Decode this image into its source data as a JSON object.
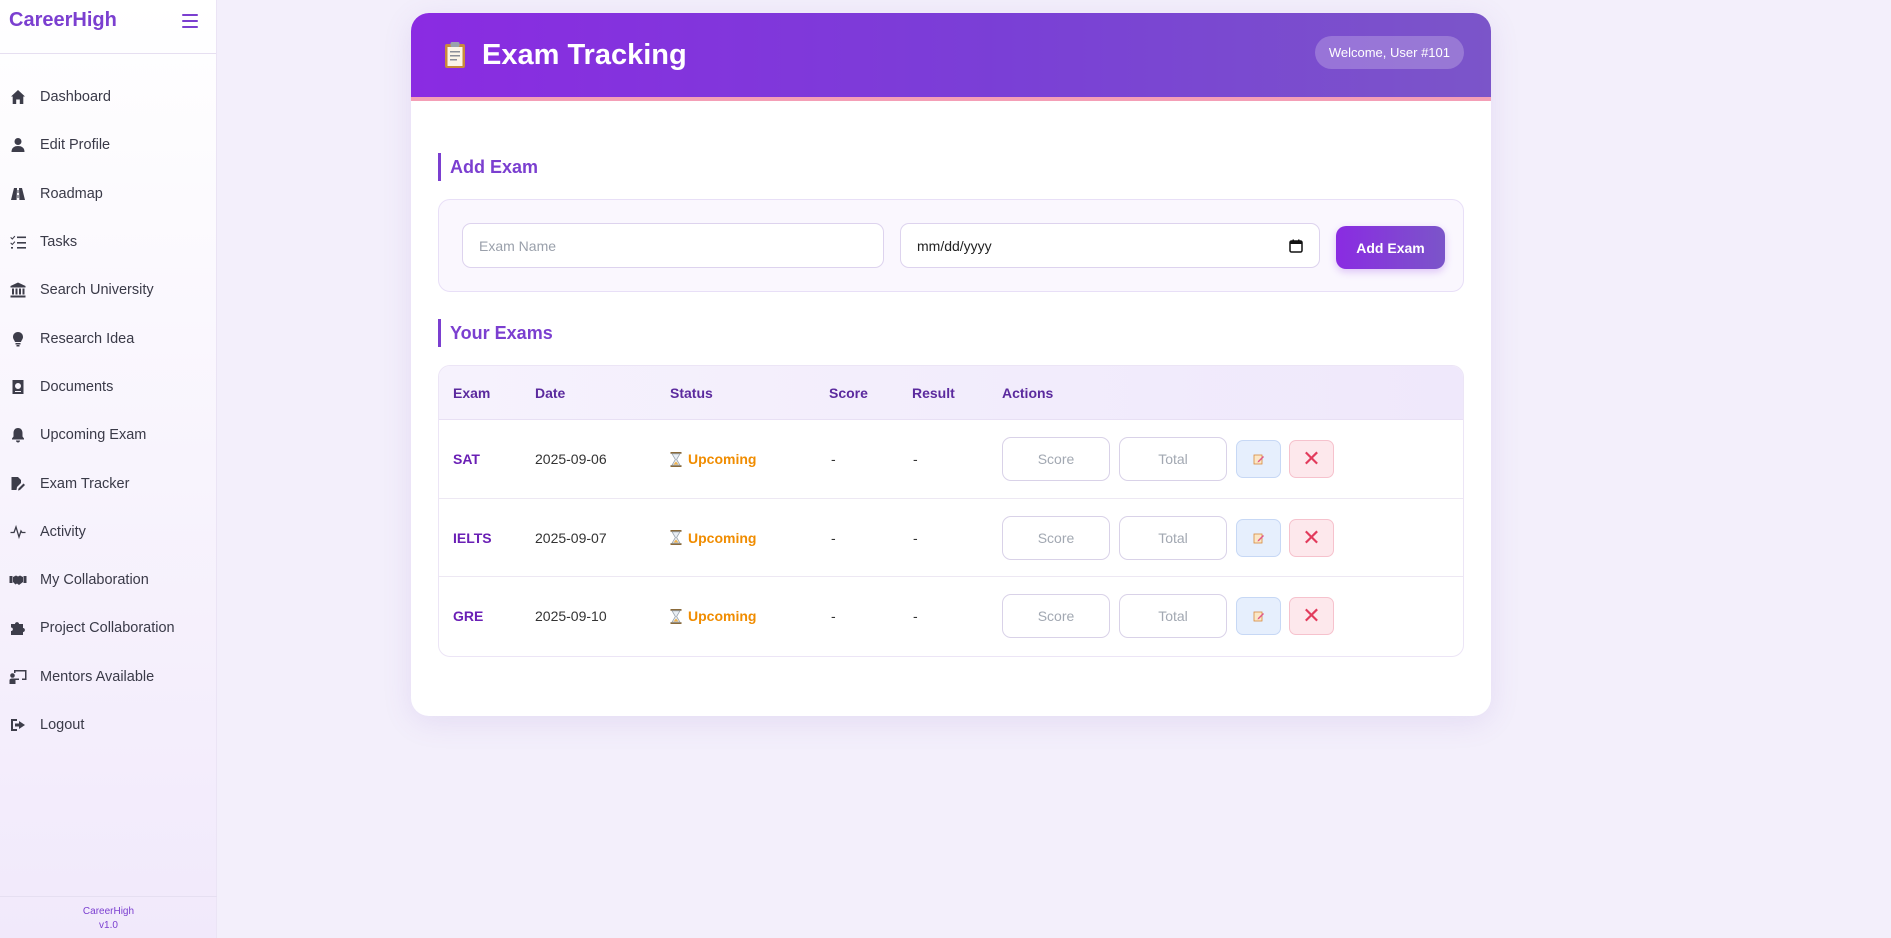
{
  "sidebar": {
    "brand": "CareerHigh",
    "items": [
      {
        "label": "Dashboard",
        "icon": "home-icon"
      },
      {
        "label": "Edit Profile",
        "icon": "user-icon"
      },
      {
        "label": "Roadmap",
        "icon": "road-icon"
      },
      {
        "label": "Tasks",
        "icon": "list-check-icon"
      },
      {
        "label": "Search University",
        "icon": "university-icon"
      },
      {
        "label": "Research Idea",
        "icon": "lightbulb-icon"
      },
      {
        "label": "Documents",
        "icon": "passport-icon"
      },
      {
        "label": "Upcoming Exam",
        "icon": "bell-icon"
      },
      {
        "label": "Exam Tracker",
        "icon": "file-signature-icon"
      },
      {
        "label": "Activity",
        "icon": "heartbeat-line-icon"
      },
      {
        "label": "My Collaboration",
        "icon": "handshake-icon"
      },
      {
        "label": "Project Collaboration",
        "icon": "puzzle-icon"
      },
      {
        "label": "Mentors Available",
        "icon": "chalkboard-user-icon"
      },
      {
        "label": "Logout",
        "icon": "sign-out-icon"
      }
    ],
    "footer": {
      "line1": "CareerHigh",
      "line2": "v1.0"
    }
  },
  "header": {
    "title": "Exam Tracking",
    "icon": "clipboard-icon",
    "welcome": "Welcome, User #101"
  },
  "add_exam": {
    "section_title": "Add Exam",
    "name_placeholder": "Exam Name",
    "date_value": "mm/dd/yyyy",
    "button_label": "Add Exam"
  },
  "exams": {
    "section_title": "Your Exams",
    "columns": [
      "Exam",
      "Date",
      "Status",
      "Score",
      "Result",
      "Actions"
    ],
    "rows": [
      {
        "exam": "SAT",
        "date": "2025-09-06",
        "status": "Upcoming",
        "score": "-",
        "result": "-"
      },
      {
        "exam": "IELTS",
        "date": "2025-09-07",
        "status": "Upcoming",
        "score": "-",
        "result": "-"
      },
      {
        "exam": "GRE",
        "date": "2025-09-10",
        "status": "Upcoming",
        "score": "-",
        "result": "-"
      }
    ],
    "score_placeholder": "Score",
    "total_placeholder": "Total",
    "delete_symbol": "✕"
  },
  "colors": {
    "accent": "#7b3fd0",
    "header_gradient_start": "#8a2be2",
    "upcoming": "#f08c00",
    "danger": "#e23b5c"
  }
}
